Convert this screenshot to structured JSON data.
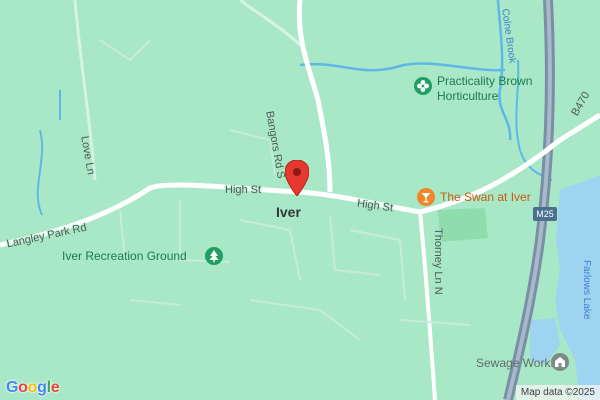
{
  "map": {
    "place": "Iver",
    "roads": {
      "high_st_west": "High St",
      "high_st_east": "High St",
      "bangors_rd": "Bangors Rd S",
      "langley_park": "Langley Park Rd",
      "love_ln": "Love Ln",
      "thorney_ln": "Thorney Ln N",
      "b470": "B470"
    },
    "water": {
      "brook": "Colne Brook",
      "lake": "Farlows Lake"
    },
    "motorway_shield": "M25",
    "pois": {
      "horticulture": "Practicality Brown\nHorticulture",
      "pub": "The Swan at Iver",
      "recreation": "Iver Recreation Ground",
      "sewage": "Sewage Works"
    },
    "attribution": "Map data ©2025",
    "logo_letters": [
      "G",
      "o",
      "o",
      "g",
      "l",
      "e"
    ],
    "colors": {
      "land": "#a8e8c6",
      "water": "#9ed4f0",
      "motorway": "#7a8fa6",
      "marker": "#e5382e",
      "pub_icon": "#f0862a",
      "park_icon": "#1f9f62"
    },
    "icons": [
      "map-marker-icon",
      "flower-icon",
      "cocktail-icon",
      "tree-icon",
      "water-works-icon"
    ]
  }
}
